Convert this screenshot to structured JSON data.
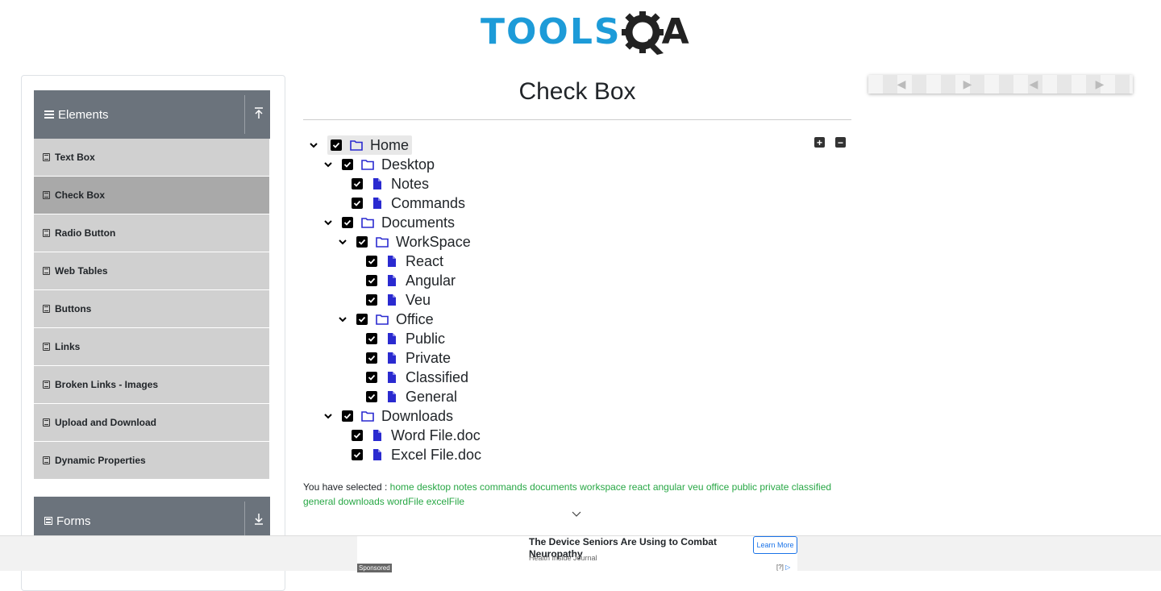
{
  "header": {
    "logo_tools": "TOOLS",
    "logo_qa": "QA"
  },
  "sidebar": {
    "group_elements": "Elements",
    "group_forms": "Forms",
    "items": [
      {
        "label": "Text Box"
      },
      {
        "label": "Check Box",
        "active": true
      },
      {
        "label": "Radio Button"
      },
      {
        "label": "Web Tables"
      },
      {
        "label": "Buttons"
      },
      {
        "label": "Links"
      },
      {
        "label": "Broken Links - Images"
      },
      {
        "label": "Upload and Download"
      },
      {
        "label": "Dynamic Properties"
      }
    ]
  },
  "main": {
    "title": "Check Box",
    "tree": {
      "home": "Home",
      "desktop": "Desktop",
      "notes": "Notes",
      "commands": "Commands",
      "documents": "Documents",
      "workspace": "WorkSpace",
      "react": "React",
      "angular": "Angular",
      "veu": "Veu",
      "office": "Office",
      "public": "Public",
      "private": "Private",
      "classified": "Classified",
      "general": "General",
      "downloads": "Downloads",
      "word": "Word File.doc",
      "excel": "Excel File.doc"
    },
    "result_label": "You have selected :",
    "result_values": "home desktop notes commands documents workspace react angular veu office public private classified general downloads wordFile excelFile"
  },
  "ad": {
    "title": "The Device Seniors Are Using to Combat Neuropathy",
    "source": "Health Inside Journal",
    "button": "Learn More",
    "sponsored": "Sponsored",
    "info": "[?]"
  },
  "colors": {
    "brand_blue": "#1d9bd8",
    "folder_blue": "#2a2ad0",
    "result_green": "#28a745",
    "group_header": "#6b737c"
  }
}
